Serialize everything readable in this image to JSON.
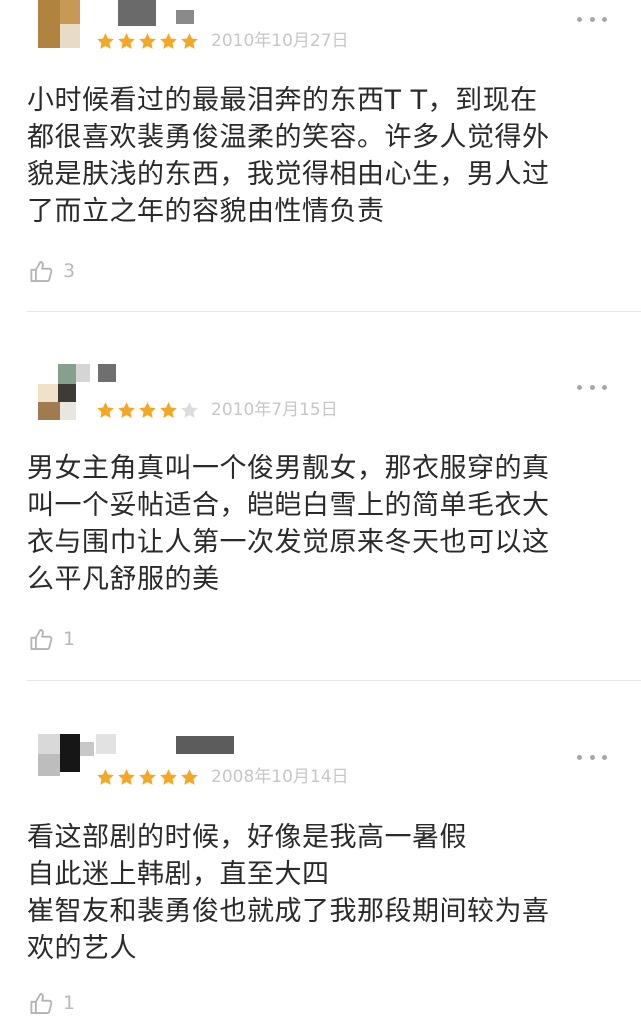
{
  "reviews": [
    {
      "stars": 5,
      "date": "2010年10月27日",
      "text_lines": [
        "小时候看过的最最泪奔的东西T T，到现在",
        "都很喜欢裴勇俊温柔的笑容。许多人觉得外",
        "貌是肤浅的东西，我觉得相由心生，男人过",
        "了而立之年的容貌由性情负责"
      ],
      "likes": "3"
    },
    {
      "stars": 4,
      "date": "2010年7月15日",
      "text_lines": [
        "男女主角真叫一个俊男靓女，那衣服穿的真",
        "叫一个妥帖适合，皑皑白雪上的简单毛衣大",
        "衣与围巾让人第一次发觉原来冬天也可以这",
        "么平凡舒服的美"
      ],
      "likes": "1"
    },
    {
      "stars": 5,
      "date": "2008年10月14日",
      "text_lines": [
        "看这部剧的时候，好像是我高一暑假",
        "自此迷上韩剧，直至大四",
        "崔智友和裴勇俊也就成了我那段期间较为喜",
        "欢的艺人"
      ],
      "likes": "1"
    }
  ],
  "colors": {
    "star_filled": "#f5a623",
    "star_empty": "#dcdcdc",
    "date": "#c7c7c7",
    "divider": "#e6e6e6"
  },
  "icons": {
    "more": "more-dots-icon",
    "like": "thumbs-up-icon",
    "star": "star-icon"
  }
}
